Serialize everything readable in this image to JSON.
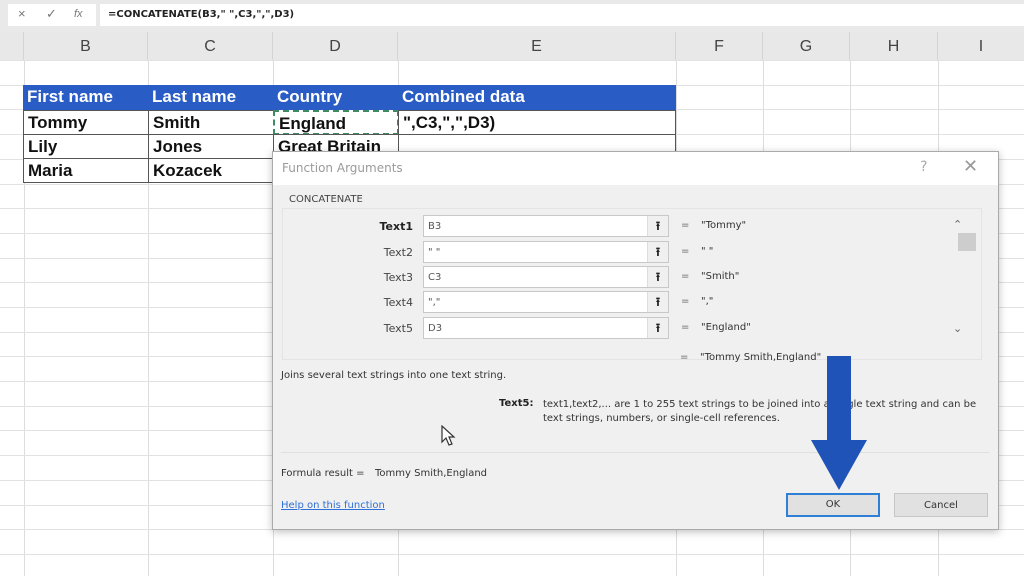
{
  "formula_bar": {
    "cancel_icon": "×",
    "confirm_icon": "✓",
    "fx_icon": "fx",
    "formula": "=CONCATENATE(B3,\" \",C3,\",\",D3)"
  },
  "columns": [
    "B",
    "C",
    "D",
    "E",
    "F",
    "G",
    "H",
    "I"
  ],
  "table": {
    "headers": [
      "First name",
      "Last name",
      "Country",
      "Combined data"
    ],
    "rows": [
      [
        "Tommy",
        "Smith",
        "England",
        "\",C3,\",\",D3)"
      ],
      [
        "Lily",
        "Jones",
        "Great Britain",
        ""
      ],
      [
        "Maria",
        "Kozacek",
        "",
        ""
      ]
    ],
    "header_color": "#2a5cc6"
  },
  "dialog": {
    "title": "Function Arguments",
    "help_icon": "?",
    "close_icon": "✕",
    "function_name": "CONCATENATE",
    "args": [
      {
        "label": "Text1",
        "value": "B3",
        "result": "\"Tommy\""
      },
      {
        "label": "Text2",
        "value": "\" \"",
        "result": "\" \""
      },
      {
        "label": "Text3",
        "value": "C3",
        "result": "\"Smith\""
      },
      {
        "label": "Text4",
        "value": "\",\"",
        "result": "\",\""
      },
      {
        "label": "Text5",
        "value": "D3",
        "result": "\"England\""
      }
    ],
    "ref_icon": "⭱",
    "equals": "=",
    "overall_result": "\"Tommy Smith,England\"",
    "description": "Joins several text strings into one text string.",
    "arg_help_label": "Text5:",
    "arg_help_text": "text1,text2,... are 1 to 255 text strings to be joined into a single text string and can be text strings, numbers, or single-cell references.",
    "formula_result_label": "Formula result =",
    "formula_result_value": "Tommy Smith,England",
    "help_link": "Help on this function",
    "ok_label": "OK",
    "cancel_label": "Cancel"
  },
  "annotation": {
    "arrow_color": "#1f53b8"
  }
}
